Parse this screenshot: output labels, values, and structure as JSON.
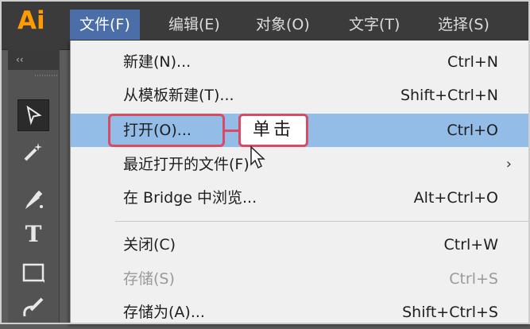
{
  "app": {
    "logo": "Ai"
  },
  "menubar": {
    "items": [
      "文件(F)",
      "编辑(E)",
      "对象(O)",
      "文字(T)",
      "选择(S)"
    ],
    "active_index": 0
  },
  "toolbar": {
    "collapse_glyph": "‹‹",
    "tools": [
      "selection-tool",
      "magic-wand-tool",
      "pen-tool",
      "type-tool",
      "rectangle-tool",
      "brush-tool"
    ],
    "type_tool_glyph": "T"
  },
  "file_menu": {
    "items": [
      {
        "label": "新建(N)...",
        "shortcut": "Ctrl+N"
      },
      {
        "label": "从模板新建(T)...",
        "shortcut": "Shift+Ctrl+N"
      },
      {
        "label": "打开(O)...",
        "shortcut": "Ctrl+O",
        "highlighted": true
      },
      {
        "label": "最近打开的文件(F)",
        "submenu_glyph": "›"
      },
      {
        "label": "在 Bridge 中浏览...",
        "shortcut": "Alt+Ctrl+O"
      },
      {
        "label": "关闭(C)",
        "shortcut": "Ctrl+W"
      },
      {
        "label": "存储(S)",
        "shortcut": "Ctrl+S",
        "disabled": true
      },
      {
        "label": "存储为(A)...",
        "shortcut": "Shift+Ctrl+S"
      }
    ]
  },
  "annotation": {
    "callout_text": "单击",
    "color": "#d94a64"
  },
  "colors": {
    "accent_logo": "#ff9a00",
    "menu_active": "#4b6ea8",
    "item_highlight": "#93bce6"
  }
}
